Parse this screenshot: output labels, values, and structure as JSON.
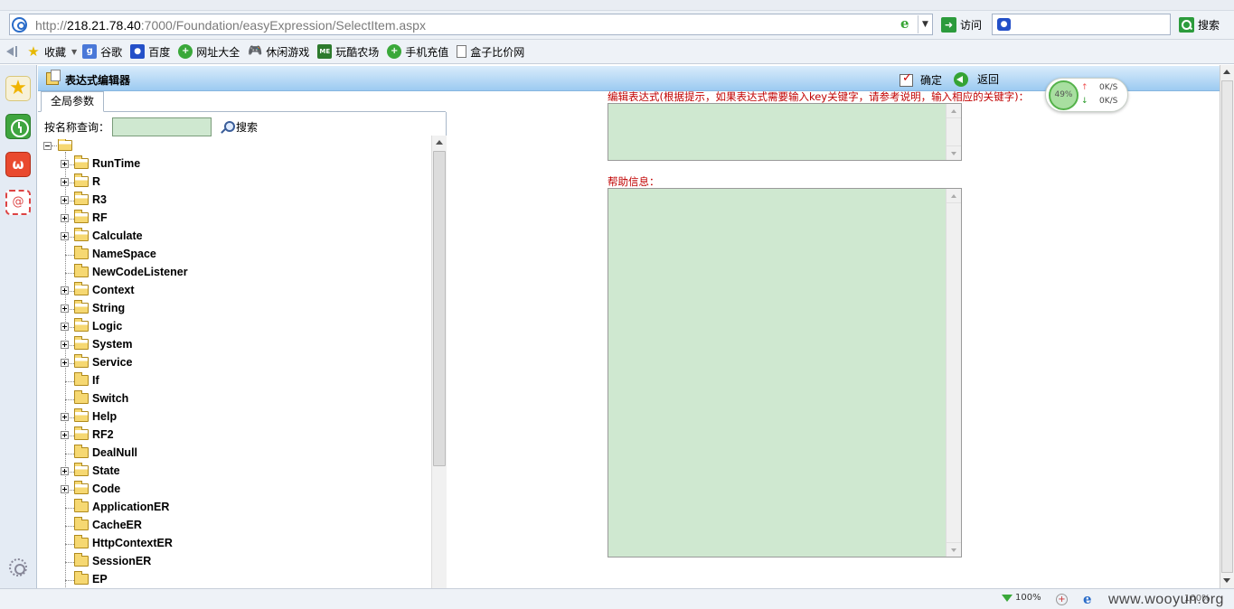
{
  "browser": {
    "url_scheme": "http://",
    "url_host": "218.21.78.40",
    "url_rest": ":7000/Foundation/easyExpression/SelectItem.aspx",
    "go_label": "访问",
    "search_label": "搜索"
  },
  "favorites": {
    "items": [
      {
        "label": "收藏",
        "icon": "star-icon"
      },
      {
        "label": "谷歌",
        "icon": "google-icon"
      },
      {
        "label": "百度",
        "icon": "baidu-icon"
      },
      {
        "label": "网址大全",
        "icon": "nav-site-icon"
      },
      {
        "label": "休闲游戏",
        "icon": "gamepad-icon"
      },
      {
        "label": "玩酷农场",
        "icon": "farm-icon"
      },
      {
        "label": "手机充值",
        "icon": "recharge-icon"
      },
      {
        "label": "盒子比价网",
        "icon": "page-icon"
      }
    ]
  },
  "editor": {
    "title": "表达式编辑器",
    "ok_label": "确定",
    "back_label": "返回",
    "tab_label": "全局参数",
    "search_label": "按名称查询：",
    "search_value": "",
    "search_button": "搜索",
    "expr_label": "编辑表达式(根据提示，如果表达式需要输入key关键字，请参考说明，输入相应的关键字)：",
    "help_label": "帮助信息："
  },
  "tree": {
    "nodes": [
      {
        "label": "RunTime",
        "expandable": true
      },
      {
        "label": "R",
        "expandable": true
      },
      {
        "label": "R3",
        "expandable": true
      },
      {
        "label": "RF",
        "expandable": true
      },
      {
        "label": "Calculate",
        "expandable": true
      },
      {
        "label": "NameSpace",
        "expandable": false
      },
      {
        "label": "NewCodeListener",
        "expandable": false
      },
      {
        "label": "Context",
        "expandable": true
      },
      {
        "label": "String",
        "expandable": true
      },
      {
        "label": "Logic",
        "expandable": true
      },
      {
        "label": "System",
        "expandable": true
      },
      {
        "label": "Service",
        "expandable": true
      },
      {
        "label": "If",
        "expandable": false
      },
      {
        "label": "Switch",
        "expandable": false
      },
      {
        "label": "Help",
        "expandable": true
      },
      {
        "label": "RF2",
        "expandable": true
      },
      {
        "label": "DealNull",
        "expandable": false
      },
      {
        "label": "State",
        "expandable": true
      },
      {
        "label": "Code",
        "expandable": true
      },
      {
        "label": "ApplicationER",
        "expandable": false
      },
      {
        "label": "CacheER",
        "expandable": false
      },
      {
        "label": "HttpContextER",
        "expandable": false
      },
      {
        "label": "SessionER",
        "expandable": false
      },
      {
        "label": "EP",
        "expandable": false
      }
    ]
  },
  "netmonitor": {
    "percent": "49%",
    "up": "0K/S",
    "down": "0K/S"
  },
  "status": {
    "zoom_left": "100%",
    "zoom_right": "100%",
    "watermark": "www.wooyun.org"
  },
  "colors": {
    "input_green": "#cfe8d0",
    "label_red": "#c00000",
    "title_blue": "#9ccaf1"
  }
}
